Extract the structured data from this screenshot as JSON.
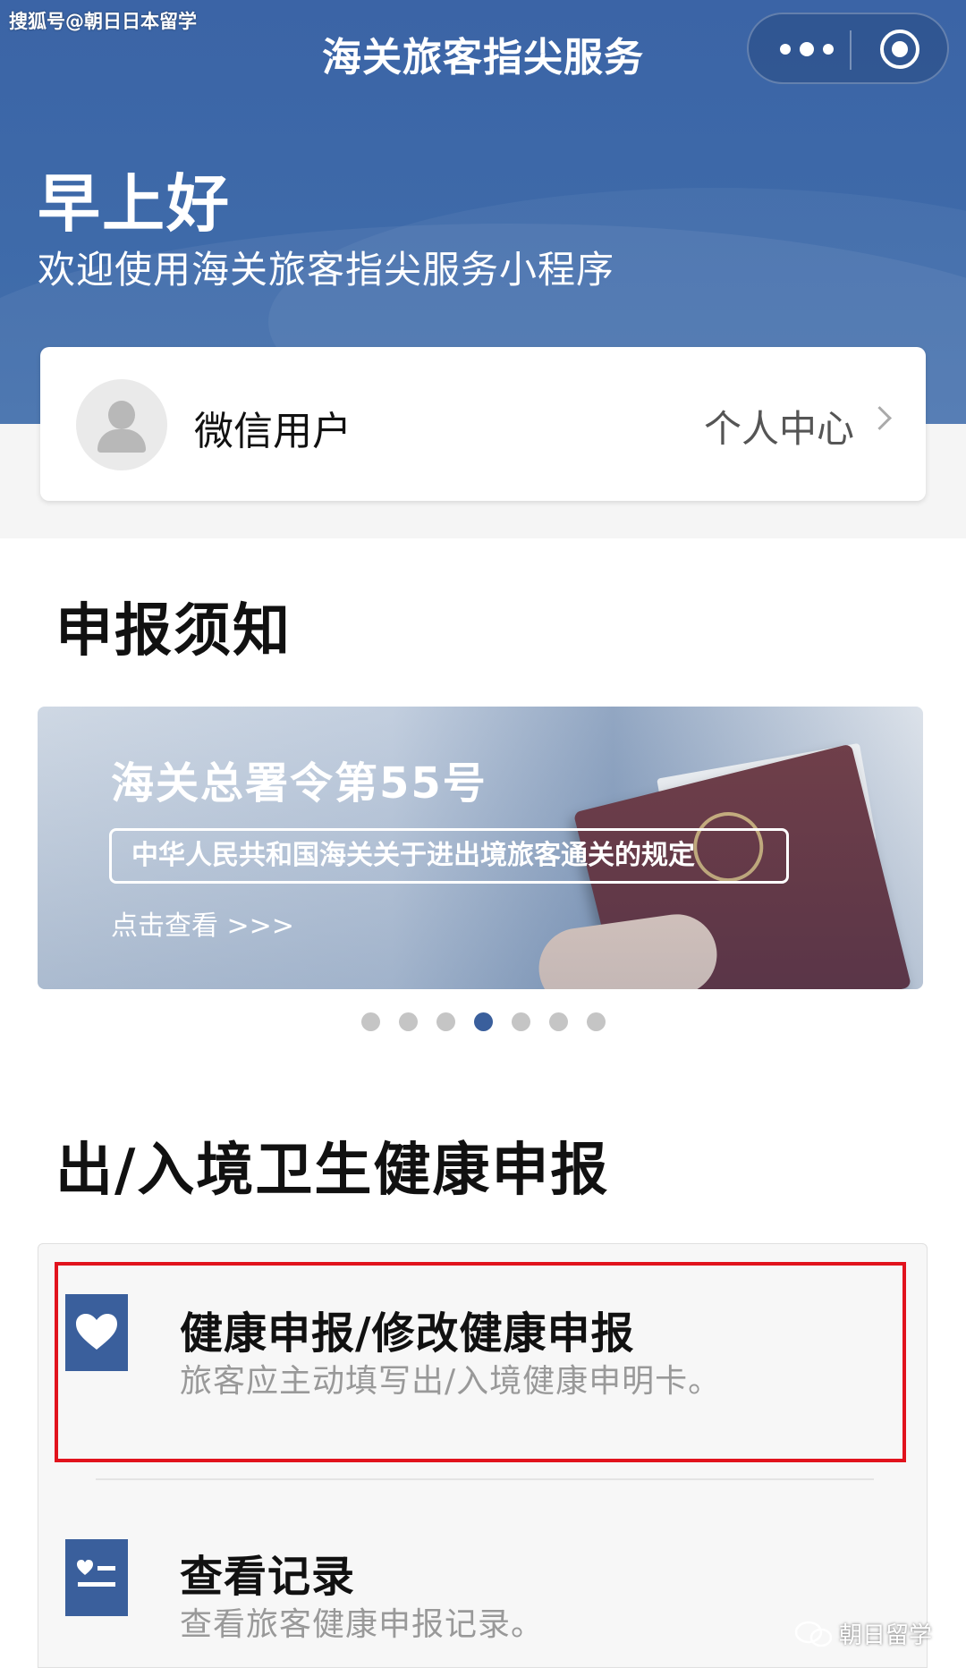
{
  "watermark_top": "搜狐号@朝日日本留学",
  "nav": {
    "title": "海关旅客指尖服务"
  },
  "header": {
    "greeting": "早上好",
    "welcome": "欢迎使用海关旅客指尖服务小程序"
  },
  "user": {
    "name": "微信用户",
    "center_link": "个人中心"
  },
  "notice": {
    "section_title": "申报须知",
    "banner": {
      "title": "海关总署令第55号",
      "subtitle": "中华人民共和国海关关于进出境旅客通关的规定",
      "link": "点击查看 >>>"
    },
    "carousel_active_index": 3,
    "carousel_count": 7
  },
  "health": {
    "section_title": "出/入境卫生健康申报",
    "items": [
      {
        "title": "健康申报/修改健康申报",
        "subtitle": "旅客应主动填写出/入境健康申明卡。",
        "icon": "heart-icon"
      },
      {
        "title": "查看记录",
        "subtitle": "查看旅客健康申报记录。",
        "icon": "record-list-icon"
      }
    ]
  },
  "watermark_bottom": "朝日留学",
  "colors": {
    "primary": "#3a5f9c",
    "highlight": "#e1131d"
  }
}
